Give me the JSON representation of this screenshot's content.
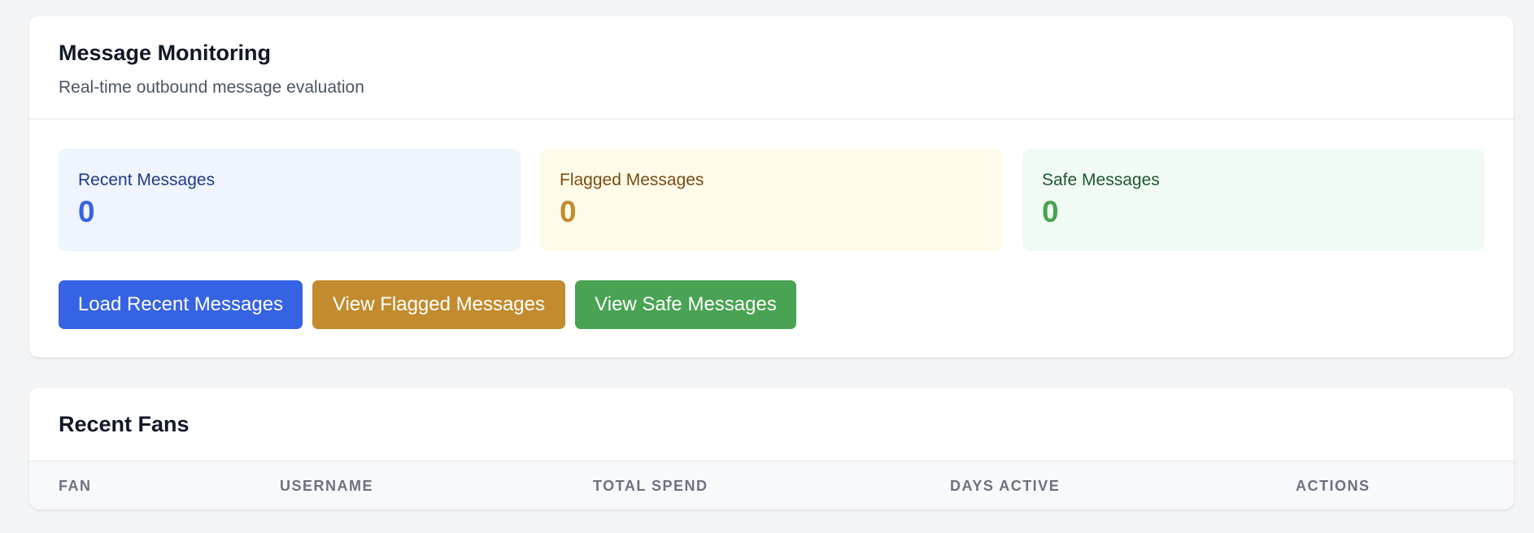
{
  "monitoring": {
    "title": "Message Monitoring",
    "subtitle": "Real-time outbound message evaluation",
    "stats": [
      {
        "label": "Recent Messages",
        "value": "0",
        "color": "#3563e3"
      },
      {
        "label": "Flagged Messages",
        "value": "0",
        "color": "#c28b2e"
      },
      {
        "label": "Safe Messages",
        "value": "0",
        "color": "#48a352"
      }
    ],
    "buttons": {
      "load_recent": "Load Recent Messages",
      "view_flagged": "View Flagged Messages",
      "view_safe": "View Safe Messages"
    }
  },
  "fans": {
    "title": "Recent Fans",
    "columns": [
      "FAN",
      "USERNAME",
      "TOTAL SPEND",
      "DAYS ACTIVE",
      "ACTIONS"
    ]
  },
  "colors": {
    "primary": "#3563e3",
    "warning": "#c28b2e",
    "success": "#48a352",
    "page_bg": "#f3f4f6"
  }
}
